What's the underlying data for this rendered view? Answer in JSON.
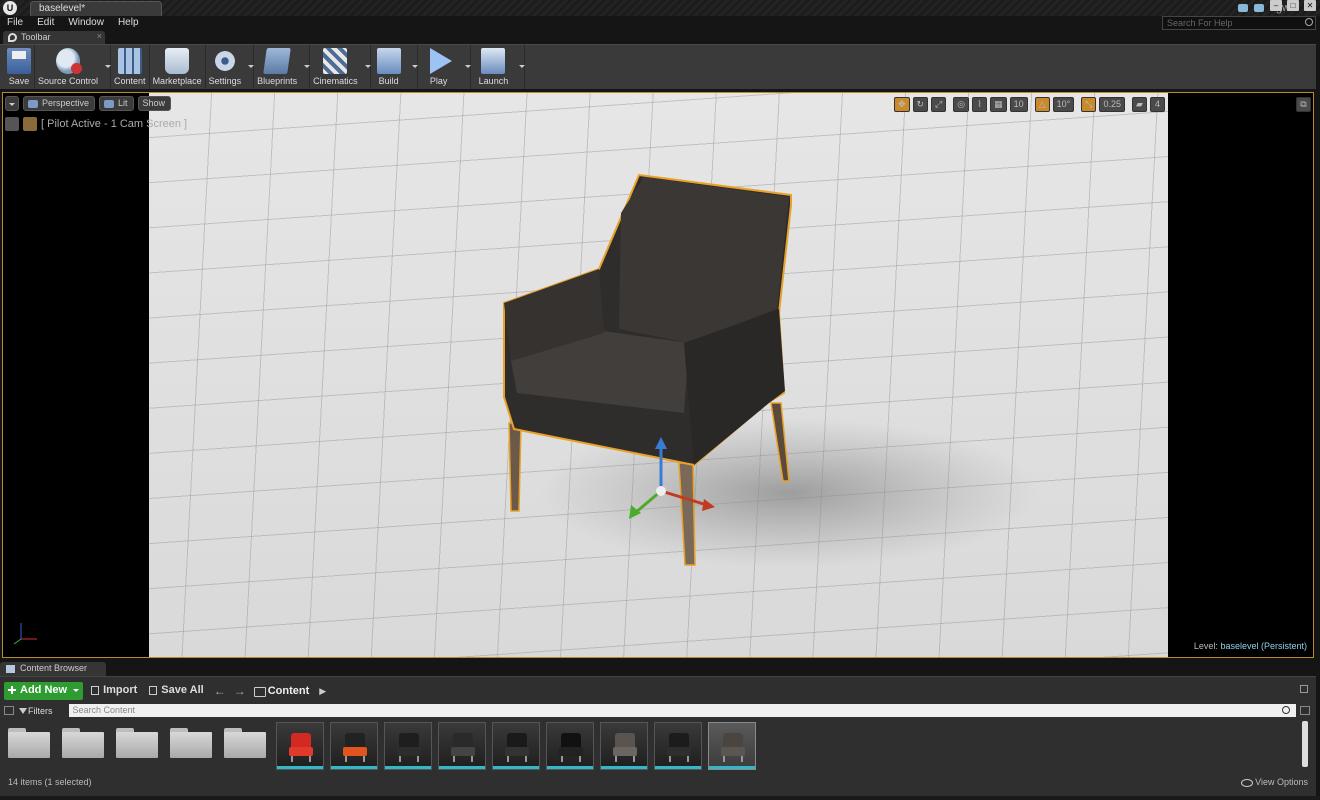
{
  "title_bar": {
    "tab_label": "baselevel*",
    "user": "cgw",
    "help_search_placeholder": "Search For Help"
  },
  "menu": [
    "File",
    "Edit",
    "Window",
    "Help"
  ],
  "toolbar": {
    "tab_label": "Toolbar",
    "buttons": [
      {
        "label": "Save",
        "icon": "save-icon"
      },
      {
        "label": "Source Control",
        "icon": "source-control-icon"
      },
      {
        "label": "Content",
        "icon": "content-icon"
      },
      {
        "label": "Marketplace",
        "icon": "marketplace-icon"
      },
      {
        "label": "Settings",
        "icon": "settings-icon"
      },
      {
        "label": "Blueprints",
        "icon": "blueprints-icon"
      },
      {
        "label": "Cinematics",
        "icon": "cinematics-icon"
      },
      {
        "label": "Build",
        "icon": "build-icon"
      },
      {
        "label": "Play",
        "icon": "play-icon"
      },
      {
        "label": "Launch",
        "icon": "launch-icon"
      }
    ]
  },
  "viewport": {
    "perspective_label": "Perspective",
    "lit_label": "Lit",
    "show_label": "Show",
    "pilot_text": "[ Pilot Active - 1 Cam Screen ]",
    "grid_snap": "10",
    "rotation_snap": "10°",
    "scale_snap": "0.25",
    "camera_speed": "4",
    "level_prefix": "Level:",
    "level_name": "baselevel (Persistent)",
    "selection_color": "#e8a22a"
  },
  "content_browser": {
    "tab_label": "Content Browser",
    "add_new_label": "Add New",
    "import_label": "Import",
    "save_all_label": "Save All",
    "path": "Content",
    "filters_label": "Filters",
    "search_placeholder": "Search Content",
    "folder_count": 5,
    "thumbnails": [
      {
        "name": "chair-red",
        "back": "#d22a22",
        "seat": "#e03a2a"
      },
      {
        "name": "chair-black-orange",
        "back": "#222",
        "seat": "#e0541e"
      },
      {
        "name": "chair-black-1",
        "back": "#1e1e1e",
        "seat": "#2c2c2c"
      },
      {
        "name": "chair-frame",
        "back": "#2a2a2a",
        "seat": "#444"
      },
      {
        "name": "chair-black-2",
        "back": "#1a1a1a",
        "seat": "#333"
      },
      {
        "name": "chair-weave",
        "back": "#111",
        "seat": "#222"
      },
      {
        "name": "chair-grey-1",
        "back": "#5a5450",
        "seat": "#6c6661"
      },
      {
        "name": "chair-black-3",
        "back": "#1c1c1c",
        "seat": "#2e2e2e"
      },
      {
        "name": "chair-grey-selected",
        "back": "#4a4540",
        "seat": "#5c5650"
      }
    ],
    "status": "14 items (1 selected)",
    "view_options_label": "View Options"
  }
}
